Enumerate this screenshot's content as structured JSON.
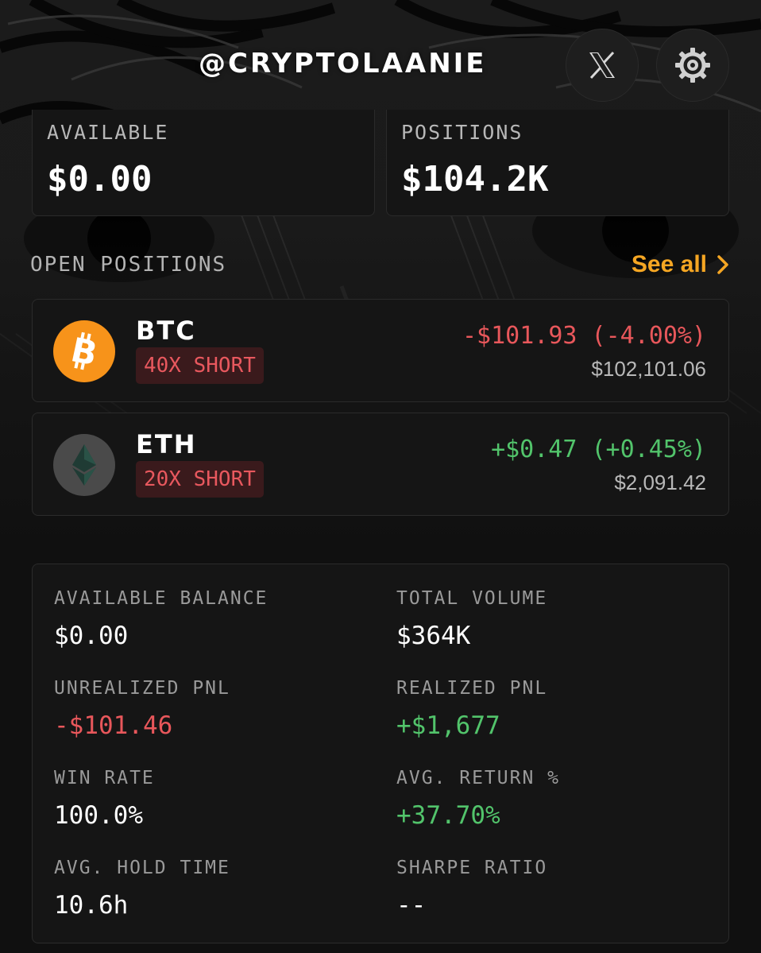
{
  "header": {
    "handle": "@CRYPTOLAANIE",
    "x_icon": "x-logo-icon",
    "settings_icon": "gear-icon"
  },
  "summary": {
    "available_label": "AVAILABLE",
    "available_value": "$0.00",
    "positions_label": "POSITIONS",
    "positions_value": "$104.2K"
  },
  "open_positions": {
    "title": "OPEN POSITIONS",
    "see_all": "See all",
    "see_all_icon": "chevron-right-icon",
    "items": [
      {
        "symbol": "BTC",
        "icon": "bitcoin-icon",
        "leverage": "40X SHORT",
        "pnl": "-$101.93 (-4.00%)",
        "pnl_direction": "negative",
        "price": "$102,101.06"
      },
      {
        "symbol": "ETH",
        "icon": "ethereum-icon",
        "leverage": "20X SHORT",
        "pnl": "+$0.47 (+0.45%)",
        "pnl_direction": "positive",
        "price": "$2,091.42"
      }
    ]
  },
  "stats": {
    "available_balance_label": "AVAILABLE BALANCE",
    "available_balance_value": "$0.00",
    "total_volume_label": "TOTAL VOLUME",
    "total_volume_value": "$364K",
    "unrealized_pnl_label": "UNREALIZED PNL",
    "unrealized_pnl_value": "-$101.46",
    "realized_pnl_label": "REALIZED PNL",
    "realized_pnl_value": "+$1,677",
    "win_rate_label": "WIN RATE",
    "win_rate_value": "100.0%",
    "avg_return_label": "AVG. RETURN %",
    "avg_return_value": "+37.70%",
    "avg_hold_time_label": "AVG. HOLD TIME",
    "avg_hold_time_value": "10.6h",
    "sharpe_ratio_label": "SHARPE RATIO",
    "sharpe_ratio_value": "--"
  },
  "colors": {
    "accent": "#f5a623",
    "negative": "#e8575b",
    "positive": "#52c46b",
    "bitcoin": "#f7931a",
    "card_bg": "#151515"
  }
}
